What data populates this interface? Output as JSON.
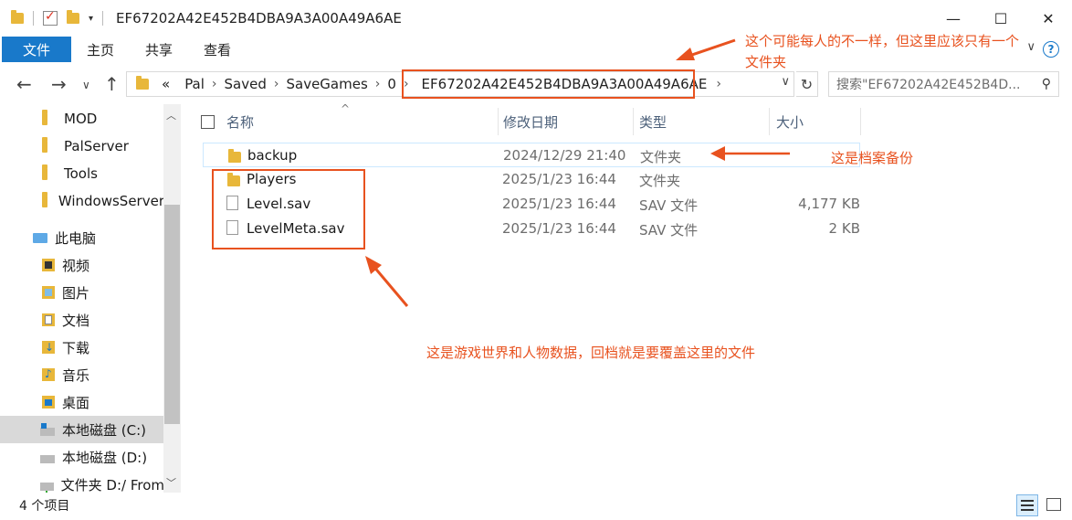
{
  "window": {
    "title": "EF67202A42E452B4DBA9A3A00A49A6AE",
    "minimize": "—",
    "maximize": "☐",
    "close": "✕"
  },
  "ribbon": {
    "tabs": [
      "文件",
      "主页",
      "共享",
      "查看"
    ],
    "help": "?",
    "collapse": "∨"
  },
  "address": {
    "overflow": "«",
    "crumbs": [
      "Pal",
      "Saved",
      "SaveGames",
      "0",
      "EF67202A42E452B4DBA9A3A00A49A6AE"
    ],
    "search_placeholder": "搜索\"EF67202A42E452B4D...",
    "nav_back": "←",
    "nav_forward": "→",
    "nav_recent": "∨",
    "nav_up": "↑",
    "refresh": "↻",
    "search_icon": "⚲"
  },
  "navpane": {
    "items": [
      {
        "label": "MOD",
        "icon": "folder-icon"
      },
      {
        "label": "PalServer",
        "icon": "folder-icon"
      },
      {
        "label": "Tools",
        "icon": "folder-icon"
      },
      {
        "label": "WindowsServer",
        "icon": "folder-icon"
      },
      {
        "label": "此电脑",
        "icon": "computer-icon"
      },
      {
        "label": "视频",
        "icon": "video-icon"
      },
      {
        "label": "图片",
        "icon": "pictures-icon"
      },
      {
        "label": "文档",
        "icon": "documents-icon"
      },
      {
        "label": "下载",
        "icon": "download-icon"
      },
      {
        "label": "音乐",
        "icon": "music-icon"
      },
      {
        "label": "桌面",
        "icon": "desktop-icon"
      },
      {
        "label": "本地磁盘 (C:)",
        "icon": "drive-icon"
      },
      {
        "label": "本地磁盘 (D:)",
        "icon": "drive-icon"
      },
      {
        "label": "文件夹 D:/ From",
        "icon": "network-drive-icon"
      }
    ]
  },
  "columns": {
    "name": "名称",
    "date": "修改日期",
    "type": "类型",
    "size": "大小"
  },
  "files": [
    {
      "name": "backup",
      "date": "2024/12/29 21:40",
      "type": "文件夹",
      "size": "",
      "icon": "folder-icon"
    },
    {
      "name": "Players",
      "date": "2025/1/23 16:44",
      "type": "文件夹",
      "size": "",
      "icon": "folder-icon"
    },
    {
      "name": "Level.sav",
      "date": "2025/1/23 16:44",
      "type": "SAV 文件",
      "size": "4,177 KB",
      "icon": "file-icon"
    },
    {
      "name": "LevelMeta.sav",
      "date": "2025/1/23 16:44",
      "type": "SAV 文件",
      "size": "2 KB",
      "icon": "file-icon"
    }
  ],
  "status": {
    "count": "4 个项目"
  },
  "annotations": {
    "folder_note_line1": "这个可能每人的不一样，但这里应该只有一个",
    "folder_note_line2": "文件夹",
    "backup_note": "这是档案备份",
    "data_note": "这是游戏世界和人物数据，回档就是要覆盖这里的文件"
  },
  "colors": {
    "accent": "#1979ca",
    "annotation": "#e8521f",
    "folder": "#e8b73a"
  }
}
